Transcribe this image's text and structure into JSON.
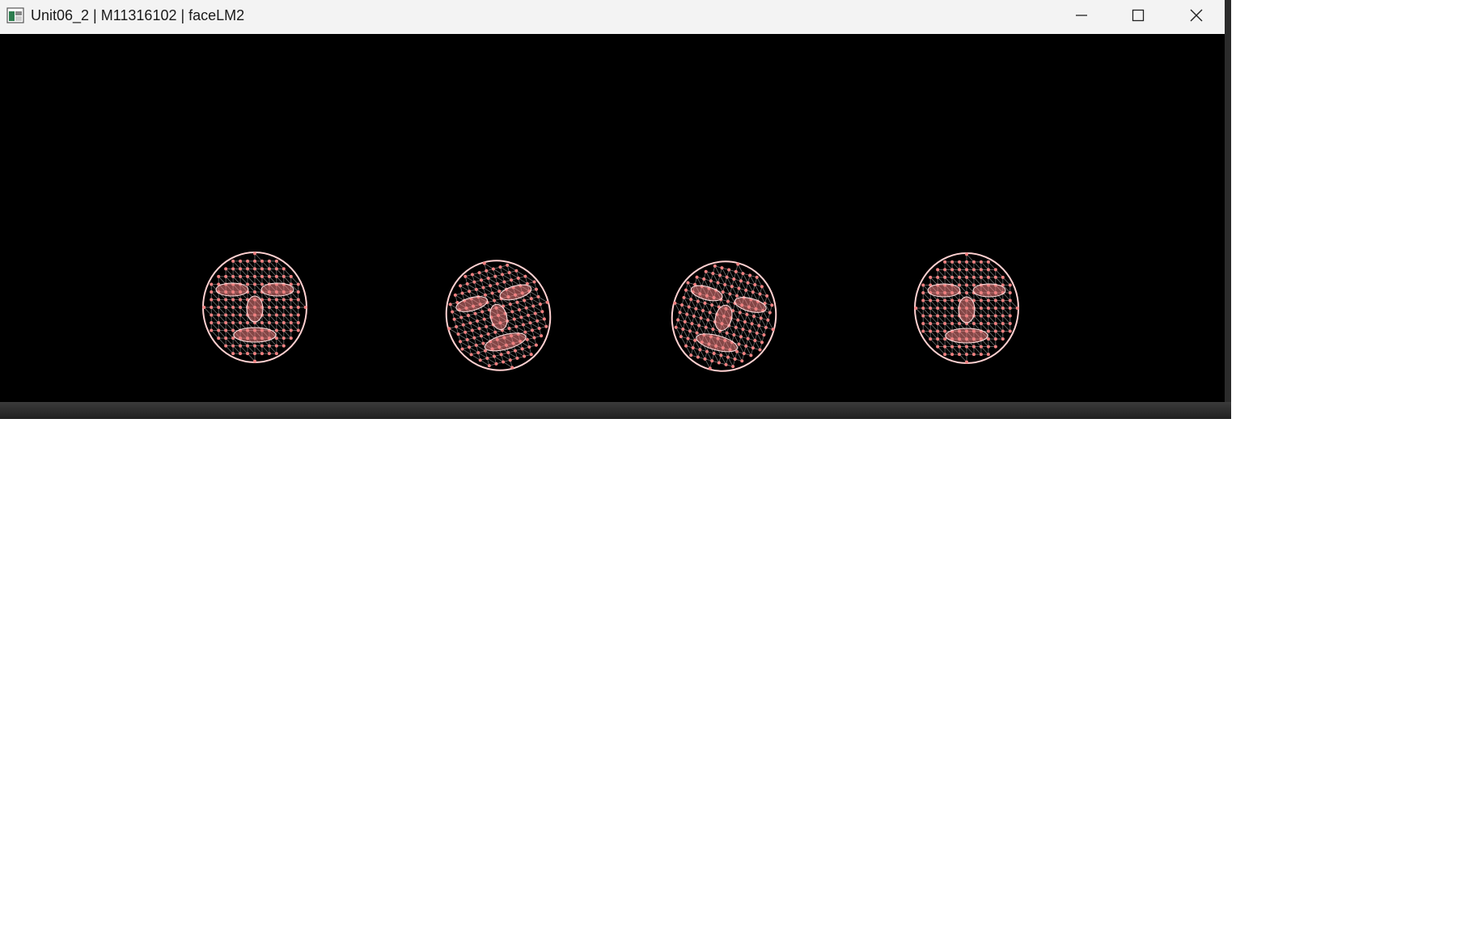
{
  "window": {
    "title": "Unit06_2 | M11316102 | faceLM2",
    "icon": "app-window-icon",
    "controls": {
      "minimize_icon": "minimize-icon",
      "maximize_icon": "maximize-icon",
      "close_icon": "close-icon"
    }
  },
  "canvas": {
    "background": "#000000",
    "mesh_color": "#f08080",
    "faces": [
      {
        "name": "face-mesh-1",
        "rotation": 0
      },
      {
        "name": "face-mesh-2",
        "rotation": -15
      },
      {
        "name": "face-mesh-3",
        "rotation": 15
      },
      {
        "name": "face-mesh-4",
        "rotation": 0
      }
    ]
  }
}
